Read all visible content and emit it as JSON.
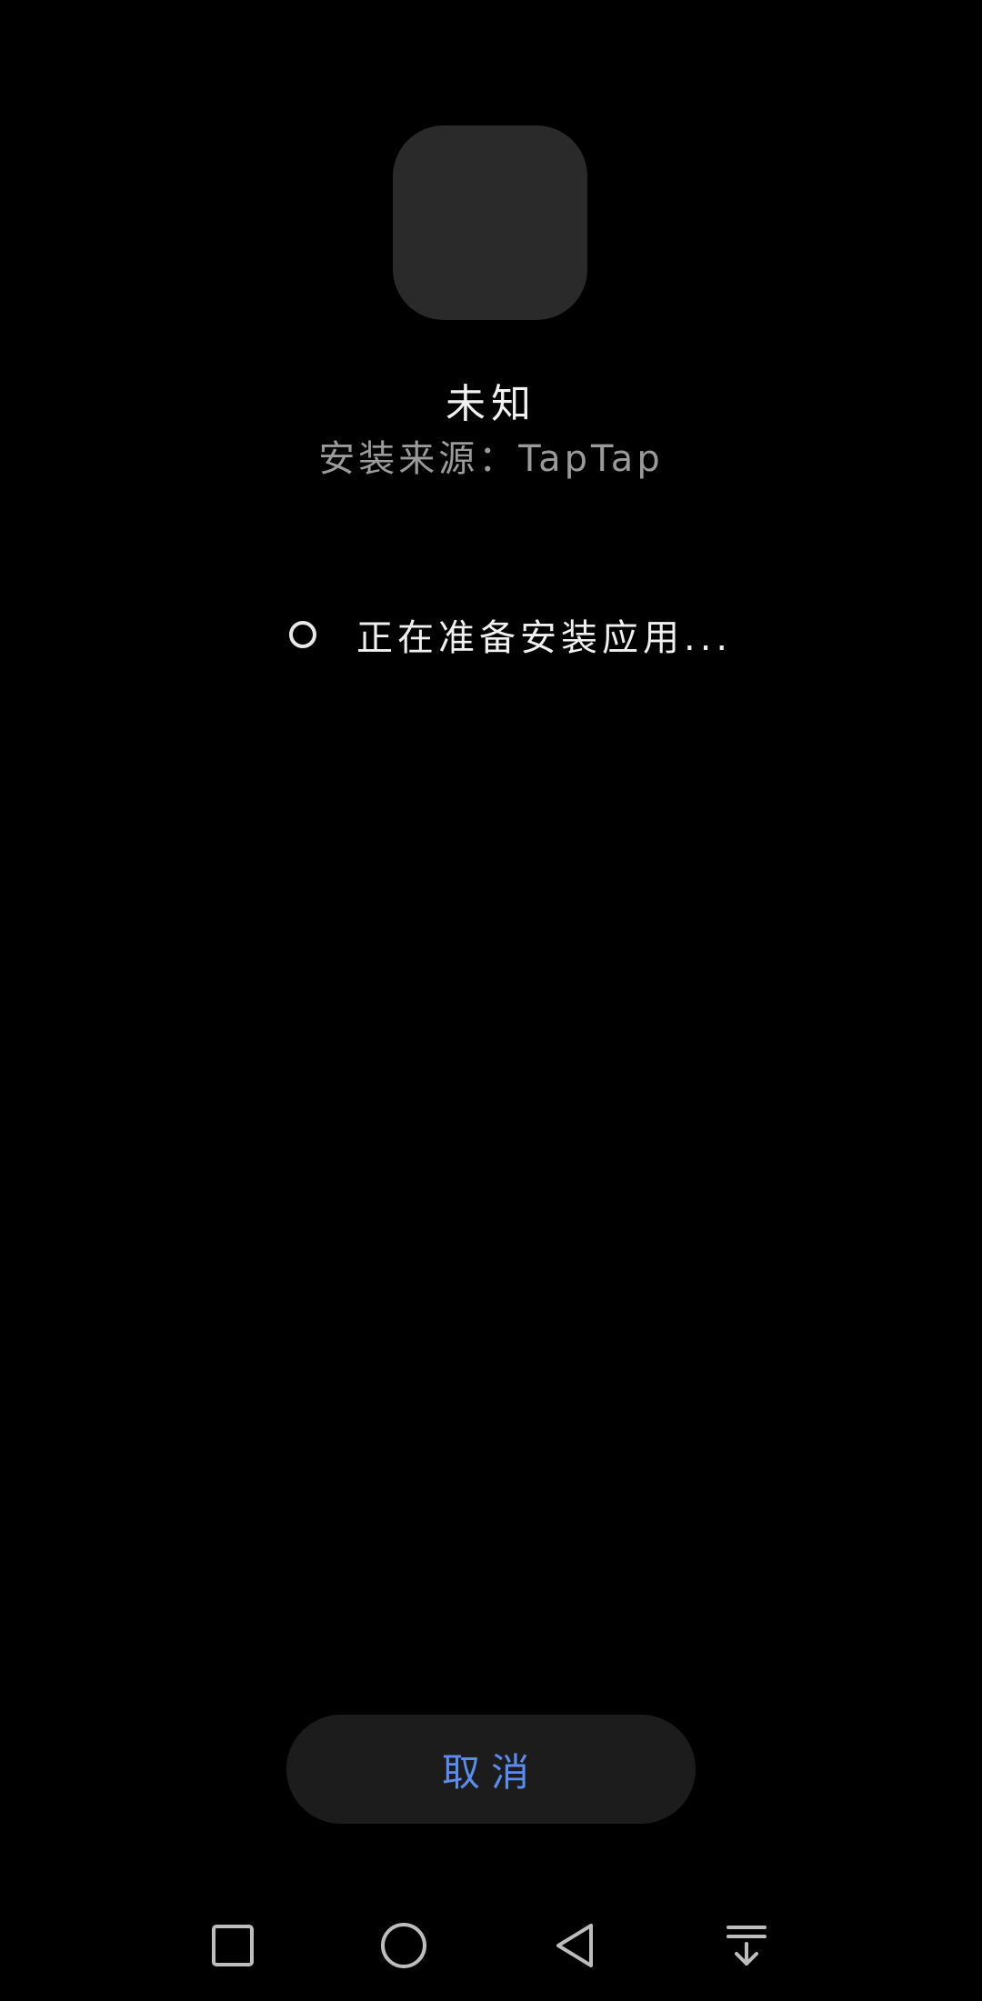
{
  "app": {
    "name": "未知",
    "install_source": "安装来源：TapTap"
  },
  "progress": {
    "status_text": "正在准备安装应用..."
  },
  "actions": {
    "cancel_label": "取消"
  },
  "nav_bar": {
    "icons": [
      "recents-icon",
      "home-icon",
      "back-icon",
      "notification-pull-icon"
    ]
  },
  "colors": {
    "background": "#000000",
    "accent": "#5b8def",
    "icon_placeholder": "#2a2a2a",
    "button_bg": "#1c1c1c"
  }
}
